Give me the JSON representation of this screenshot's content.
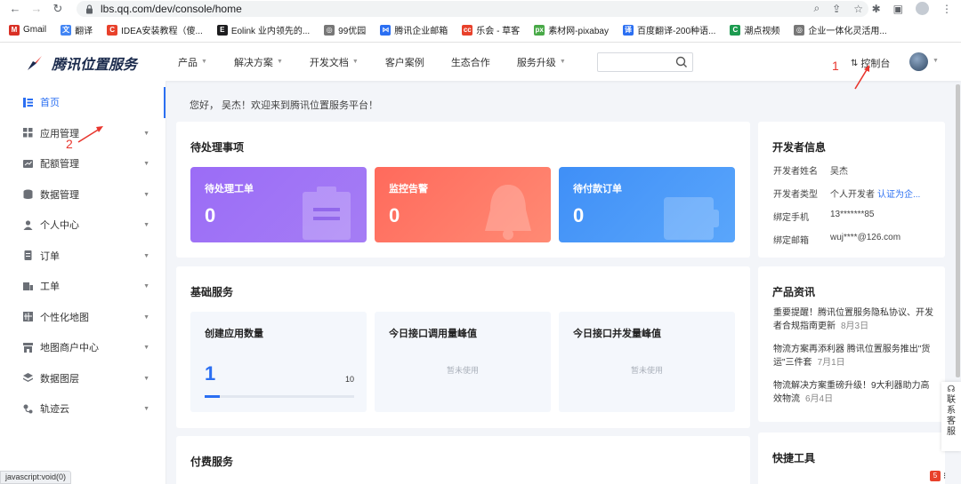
{
  "browser": {
    "url": "lbs.qq.com/dev/console/home",
    "bookmarks": [
      {
        "label": "Gmail",
        "icon": "gmail-icon",
        "color": "#d93025",
        "glyph": "M"
      },
      {
        "label": "翻译",
        "icon": "translate-icon",
        "color": "#4285f4",
        "glyph": "文"
      },
      {
        "label": "IDEA安装教程（傻...",
        "icon": "csdn-icon",
        "color": "#e8412b",
        "glyph": "C"
      },
      {
        "label": "Eolink 业内领先的...",
        "icon": "eolink-icon",
        "color": "#1d1d1f",
        "glyph": "E"
      },
      {
        "label": "99优园",
        "icon": "globe-icon",
        "color": "#777777",
        "glyph": "◎"
      },
      {
        "label": "腾讯企业邮箱",
        "icon": "tencent-mail-icon",
        "color": "#2b6ff2",
        "glyph": "⋈"
      },
      {
        "label": "乐会 - 草客",
        "icon": "cc-icon",
        "color": "#e8412b",
        "glyph": "cc"
      },
      {
        "label": "素材网-pixabay",
        "icon": "pixabay-icon",
        "color": "#48a947",
        "glyph": "px"
      },
      {
        "label": "百度翻译-200种语...",
        "icon": "baidu-translate-icon",
        "color": "#2b6ff2",
        "glyph": "译"
      },
      {
        "label": "潮点视频",
        "icon": "video-icon",
        "color": "#1d9b50",
        "glyph": "C"
      },
      {
        "label": "企业一体化灵活用...",
        "icon": "globe-icon",
        "color": "#777777",
        "glyph": "◎"
      }
    ]
  },
  "header": {
    "logo_text": "腾讯位置服务",
    "nav": [
      {
        "label": "产品",
        "dropdown": true
      },
      {
        "label": "解决方案",
        "dropdown": true
      },
      {
        "label": "开发文档",
        "dropdown": true
      },
      {
        "label": "客户案例",
        "dropdown": false
      },
      {
        "label": "生态合作",
        "dropdown": false
      },
      {
        "label": "服务升级",
        "dropdown": true
      }
    ],
    "search_placeholder": "",
    "console_label": "控制台"
  },
  "annotations": {
    "one": "1",
    "two": "2"
  },
  "sidebar": {
    "items": [
      {
        "label": "首页",
        "icon": "home-icon",
        "active": true,
        "dropdown": false
      },
      {
        "label": "应用管理",
        "icon": "app-grid-icon",
        "active": false,
        "dropdown": true
      },
      {
        "label": "配额管理",
        "icon": "quota-icon",
        "active": false,
        "dropdown": true
      },
      {
        "label": "数据管理",
        "icon": "database-icon",
        "active": false,
        "dropdown": true
      },
      {
        "label": "个人中心",
        "icon": "user-icon",
        "active": false,
        "dropdown": true
      },
      {
        "label": "订单",
        "icon": "order-icon",
        "active": false,
        "dropdown": true
      },
      {
        "label": "工单",
        "icon": "ticket-icon",
        "active": false,
        "dropdown": true
      },
      {
        "label": "个性化地图",
        "icon": "custom-map-icon",
        "active": false,
        "dropdown": true
      },
      {
        "label": "地图商户中心",
        "icon": "merchant-icon",
        "active": false,
        "dropdown": true
      },
      {
        "label": "数据图层",
        "icon": "layers-icon",
        "active": false,
        "dropdown": true
      },
      {
        "label": "轨迹云",
        "icon": "track-icon",
        "active": false,
        "dropdown": true
      }
    ]
  },
  "main": {
    "greeting": "您好， 吴杰！欢迎来到腾讯位置服务平台！",
    "pending": {
      "title": "待处理事项",
      "tiles": [
        {
          "label": "待处理工单",
          "value": "0",
          "color_from": "#9b6cf6",
          "color_to": "#a57df5",
          "icon": "clipboard-icon"
        },
        {
          "label": "监控告警",
          "value": "0",
          "color_from": "#ff6a5c",
          "color_to": "#ff8a74",
          "icon": "bell-icon"
        },
        {
          "label": "待付款订单",
          "value": "0",
          "color_from": "#3f8ff7",
          "color_to": "#5aa6fb",
          "icon": "wallet-icon"
        }
      ]
    },
    "basic": {
      "title": "基础服务",
      "stats": [
        {
          "title": "创建应用数量",
          "value": "1",
          "max": "10",
          "progress": 0.1
        },
        {
          "title": "今日接口调用量峰值",
          "empty": "暂未使用"
        },
        {
          "title": "今日接口并发量峰值",
          "empty": "暂未使用"
        }
      ]
    },
    "paid": {
      "title": "付费服务"
    }
  },
  "developer": {
    "title": "开发者信息",
    "rows": [
      {
        "key": "开发者姓名",
        "value": "吴杰",
        "link": ""
      },
      {
        "key": "开发者类型",
        "value": "个人开发者",
        "link": "认证为企..."
      },
      {
        "key": "绑定手机",
        "value": "13*******85",
        "link": ""
      },
      {
        "key": "绑定邮箱",
        "value": "wuj****@126.com",
        "link": ""
      }
    ]
  },
  "news": {
    "title": "产品资讯",
    "items": [
      {
        "text": "重要提醒！腾讯位置服务隐私协议、开发者合规指南更新",
        "date": "8月3日"
      },
      {
        "text": "物流方案再添利器 腾讯位置服务推出\"货运\"三件套",
        "date": "7月1日"
      },
      {
        "text": "物流解决方案重磅升级！9大利器助力高效物流",
        "date": "6月4日"
      }
    ]
  },
  "tools": {
    "title": "快捷工具"
  },
  "service_button": "联系客服",
  "status_bar": "javascript:void(0)",
  "colors": {
    "accent": "#2b6ff2",
    "annotation": "#e8362e"
  }
}
